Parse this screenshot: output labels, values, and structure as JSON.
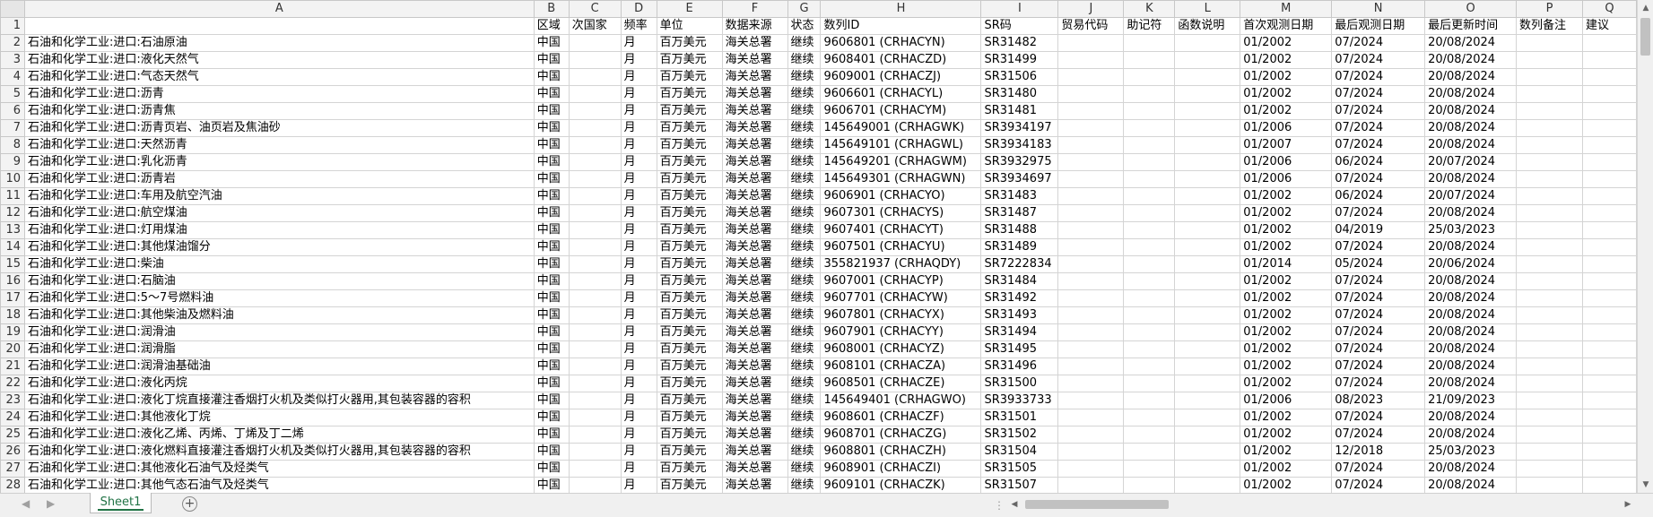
{
  "columns": [
    "A",
    "B",
    "C",
    "D",
    "E",
    "F",
    "G",
    "H",
    "I",
    "J",
    "K",
    "L",
    "M",
    "N",
    "O",
    "P",
    "Q"
  ],
  "header": [
    "",
    "区域",
    "次国家",
    "频率",
    "单位",
    "数据来源",
    "状态",
    "数列ID",
    "SR码",
    "贸易代码",
    "助记符",
    "函数说明",
    "首次观测日期",
    "最后观测日期",
    "最后更新时间",
    "数列备注",
    "建议"
  ],
  "rows": [
    [
      "石油和化学工业:进口:石油原油",
      "中国",
      "",
      "月",
      "百万美元",
      "海关总署",
      "继续",
      "9606801 (CRHACYN)",
      "SR31482",
      "",
      "",
      "",
      "01/2002",
      "07/2024",
      "20/08/2024",
      "",
      ""
    ],
    [
      "石油和化学工业:进口:液化天然气",
      "中国",
      "",
      "月",
      "百万美元",
      "海关总署",
      "继续",
      "9608401 (CRHACZD)",
      "SR31499",
      "",
      "",
      "",
      "01/2002",
      "07/2024",
      "20/08/2024",
      "",
      ""
    ],
    [
      "石油和化学工业:进口:气态天然气",
      "中国",
      "",
      "月",
      "百万美元",
      "海关总署",
      "继续",
      "9609001 (CRHACZJ)",
      "SR31506",
      "",
      "",
      "",
      "01/2002",
      "07/2024",
      "20/08/2024",
      "",
      ""
    ],
    [
      "石油和化学工业:进口:沥青",
      "中国",
      "",
      "月",
      "百万美元",
      "海关总署",
      "继续",
      "9606601 (CRHACYL)",
      "SR31480",
      "",
      "",
      "",
      "01/2002",
      "07/2024",
      "20/08/2024",
      "",
      ""
    ],
    [
      "石油和化学工业:进口:沥青焦",
      "中国",
      "",
      "月",
      "百万美元",
      "海关总署",
      "继续",
      "9606701 (CRHACYM)",
      "SR31481",
      "",
      "",
      "",
      "01/2002",
      "07/2024",
      "20/08/2024",
      "",
      ""
    ],
    [
      "石油和化学工业:进口:沥青页岩、油页岩及焦油砂",
      "中国",
      "",
      "月",
      "百万美元",
      "海关总署",
      "继续",
      "145649001 (CRHAGWK)",
      "SR3934197",
      "",
      "",
      "",
      "01/2006",
      "07/2024",
      "20/08/2024",
      "",
      ""
    ],
    [
      "石油和化学工业:进口:天然沥青",
      "中国",
      "",
      "月",
      "百万美元",
      "海关总署",
      "继续",
      "145649101 (CRHAGWL)",
      "SR3934183",
      "",
      "",
      "",
      "01/2007",
      "07/2024",
      "20/08/2024",
      "",
      ""
    ],
    [
      "石油和化学工业:进口:乳化沥青",
      "中国",
      "",
      "月",
      "百万美元",
      "海关总署",
      "继续",
      "145649201 (CRHAGWM)",
      "SR3932975",
      "",
      "",
      "",
      "01/2006",
      "06/2024",
      "20/07/2024",
      "",
      ""
    ],
    [
      "石油和化学工业:进口:沥青岩",
      "中国",
      "",
      "月",
      "百万美元",
      "海关总署",
      "继续",
      "145649301 (CRHAGWN)",
      "SR3934697",
      "",
      "",
      "",
      "01/2006",
      "07/2024",
      "20/08/2024",
      "",
      ""
    ],
    [
      "石油和化学工业:进口:车用及航空汽油",
      "中国",
      "",
      "月",
      "百万美元",
      "海关总署",
      "继续",
      "9606901 (CRHACYO)",
      "SR31483",
      "",
      "",
      "",
      "01/2002",
      "06/2024",
      "20/07/2024",
      "",
      ""
    ],
    [
      "石油和化学工业:进口:航空煤油",
      "中国",
      "",
      "月",
      "百万美元",
      "海关总署",
      "继续",
      "9607301 (CRHACYS)",
      "SR31487",
      "",
      "",
      "",
      "01/2002",
      "07/2024",
      "20/08/2024",
      "",
      ""
    ],
    [
      "石油和化学工业:进口:灯用煤油",
      "中国",
      "",
      "月",
      "百万美元",
      "海关总署",
      "继续",
      "9607401 (CRHACYT)",
      "SR31488",
      "",
      "",
      "",
      "01/2002",
      "04/2019",
      "25/03/2023",
      "",
      ""
    ],
    [
      "石油和化学工业:进口:其他煤油馏分",
      "中国",
      "",
      "月",
      "百万美元",
      "海关总署",
      "继续",
      "9607501 (CRHACYU)",
      "SR31489",
      "",
      "",
      "",
      "01/2002",
      "07/2024",
      "20/08/2024",
      "",
      ""
    ],
    [
      "石油和化学工业:进口:柴油",
      "中国",
      "",
      "月",
      "百万美元",
      "海关总署",
      "继续",
      "355821937 (CRHAQDY)",
      "SR7222834",
      "",
      "",
      "",
      "01/2014",
      "05/2024",
      "20/06/2024",
      "",
      ""
    ],
    [
      "石油和化学工业:进口:石脑油",
      "中国",
      "",
      "月",
      "百万美元",
      "海关总署",
      "继续",
      "9607001 (CRHACYP)",
      "SR31484",
      "",
      "",
      "",
      "01/2002",
      "07/2024",
      "20/08/2024",
      "",
      ""
    ],
    [
      "石油和化学工业:进口:5～7号燃料油",
      "中国",
      "",
      "月",
      "百万美元",
      "海关总署",
      "继续",
      "9607701 (CRHACYW)",
      "SR31492",
      "",
      "",
      "",
      "01/2002",
      "07/2024",
      "20/08/2024",
      "",
      ""
    ],
    [
      "石油和化学工业:进口:其他柴油及燃料油",
      "中国",
      "",
      "月",
      "百万美元",
      "海关总署",
      "继续",
      "9607801 (CRHACYX)",
      "SR31493",
      "",
      "",
      "",
      "01/2002",
      "07/2024",
      "20/08/2024",
      "",
      ""
    ],
    [
      "石油和化学工业:进口:润滑油",
      "中国",
      "",
      "月",
      "百万美元",
      "海关总署",
      "继续",
      "9607901 (CRHACYY)",
      "SR31494",
      "",
      "",
      "",
      "01/2002",
      "07/2024",
      "20/08/2024",
      "",
      ""
    ],
    [
      "石油和化学工业:进口:润滑脂",
      "中国",
      "",
      "月",
      "百万美元",
      "海关总署",
      "继续",
      "9608001 (CRHACYZ)",
      "SR31495",
      "",
      "",
      "",
      "01/2002",
      "07/2024",
      "20/08/2024",
      "",
      ""
    ],
    [
      "石油和化学工业:进口:润滑油基础油",
      "中国",
      "",
      "月",
      "百万美元",
      "海关总署",
      "继续",
      "9608101 (CRHACZA)",
      "SR31496",
      "",
      "",
      "",
      "01/2002",
      "07/2024",
      "20/08/2024",
      "",
      ""
    ],
    [
      "石油和化学工业:进口:液化丙烷",
      "中国",
      "",
      "月",
      "百万美元",
      "海关总署",
      "继续",
      "9608501 (CRHACZE)",
      "SR31500",
      "",
      "",
      "",
      "01/2002",
      "07/2024",
      "20/08/2024",
      "",
      ""
    ],
    [
      "石油和化学工业:进口:液化丁烷直接灌注香烟打火机及类似打火器用,其包装容器的容积",
      "中国",
      "",
      "月",
      "百万美元",
      "海关总署",
      "继续",
      "145649401 (CRHAGWO)",
      "SR3933733",
      "",
      "",
      "",
      "01/2006",
      "08/2023",
      "21/09/2023",
      "",
      ""
    ],
    [
      "石油和化学工业:进口:其他液化丁烷",
      "中国",
      "",
      "月",
      "百万美元",
      "海关总署",
      "继续",
      "9608601 (CRHACZF)",
      "SR31501",
      "",
      "",
      "",
      "01/2002",
      "07/2024",
      "20/08/2024",
      "",
      ""
    ],
    [
      "石油和化学工业:进口:液化乙烯、丙烯、丁烯及丁二烯",
      "中国",
      "",
      "月",
      "百万美元",
      "海关总署",
      "继续",
      "9608701 (CRHACZG)",
      "SR31502",
      "",
      "",
      "",
      "01/2002",
      "07/2024",
      "20/08/2024",
      "",
      ""
    ],
    [
      "石油和化学工业:进口:液化燃料直接灌注香烟打火机及类似打火器用,其包装容器的容积",
      "中国",
      "",
      "月",
      "百万美元",
      "海关总署",
      "继续",
      "9608801 (CRHACZH)",
      "SR31504",
      "",
      "",
      "",
      "01/2002",
      "12/2018",
      "25/03/2023",
      "",
      ""
    ],
    [
      "石油和化学工业:进口:其他液化石油气及烃类气",
      "中国",
      "",
      "月",
      "百万美元",
      "海关总署",
      "继续",
      "9608901 (CRHACZI)",
      "SR31505",
      "",
      "",
      "",
      "01/2002",
      "07/2024",
      "20/08/2024",
      "",
      ""
    ],
    [
      "石油和化学工业:进口:其他气态石油气及烃类气",
      "中国",
      "",
      "月",
      "百万美元",
      "海关总署",
      "继续",
      "9609101 (CRHACZK)",
      "SR31507",
      "",
      "",
      "",
      "01/2002",
      "07/2024",
      "20/08/2024",
      "",
      ""
    ]
  ],
  "sheet_tab": "Sheet1",
  "add_sheet_label": "+",
  "theme": {
    "accent": "#217346",
    "header_bg": "#f3f3f3",
    "gridline": "#d4d4d4"
  }
}
